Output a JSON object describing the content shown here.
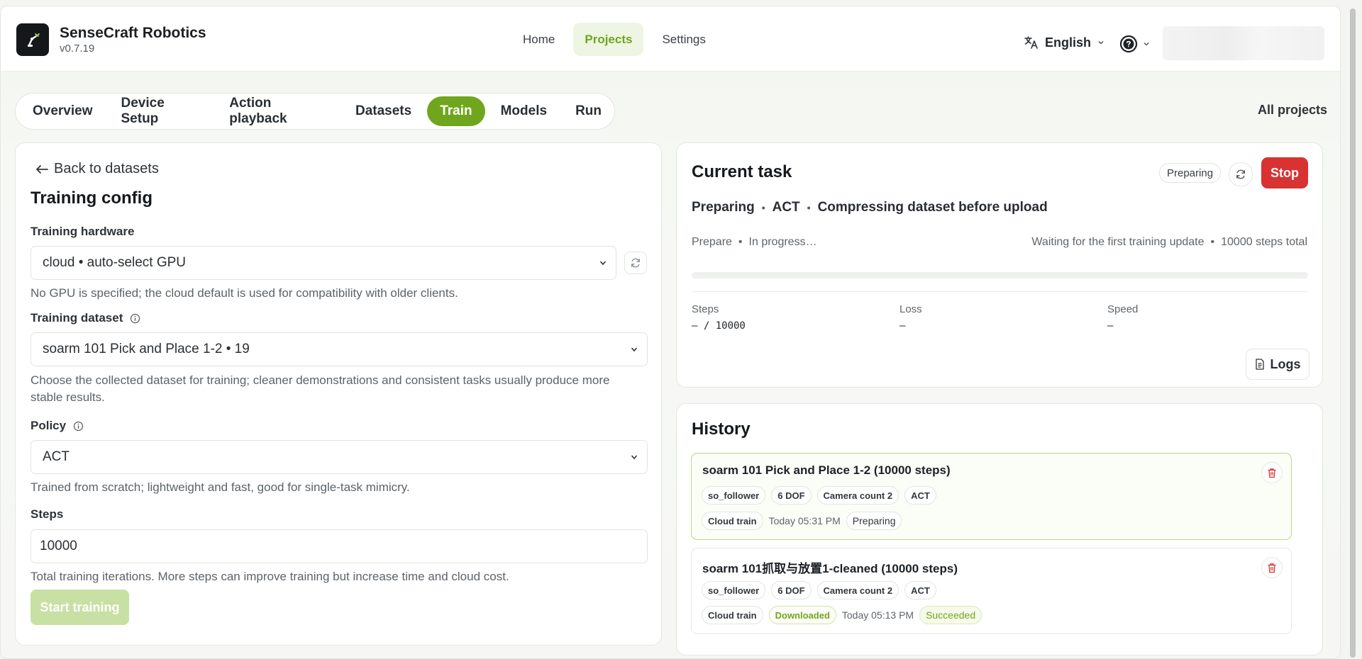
{
  "brand": {
    "name": "SenseCraft Robotics",
    "version": "v0.7.19"
  },
  "topnav": [
    {
      "label": "Home"
    },
    {
      "label": "Projects"
    },
    {
      "label": "Settings"
    }
  ],
  "header": {
    "language": "English"
  },
  "subnav": {
    "tabs": [
      {
        "label": "Overview"
      },
      {
        "label": "Device Setup"
      },
      {
        "label": "Action playback"
      },
      {
        "label": "Datasets"
      },
      {
        "label": "Train"
      },
      {
        "label": "Models"
      },
      {
        "label": "Run"
      }
    ],
    "all_projects": "All projects"
  },
  "training": {
    "back": "Back to datasets",
    "title": "Training config",
    "hardware_label": "Training hardware",
    "hardware_value": "cloud • auto-select GPU",
    "hardware_help": "No GPU is specified; the cloud default is used for compatibility with older clients.",
    "dataset_label": "Training dataset",
    "dataset_value": "soarm 101 Pick and Place 1-2 • 19",
    "dataset_help": "Choose the collected dataset for training; cleaner demonstrations and consistent tasks usually produce more stable results.",
    "policy_label": "Policy",
    "policy_value": "ACT",
    "policy_help": "Trained from scratch; lightweight and fast, good for single-task mimicry.",
    "steps_label": "Steps",
    "steps_value": "10000",
    "steps_help": "Total training iterations. More steps can improve training but increase time and cloud cost.",
    "start": "Start training"
  },
  "current_task": {
    "title": "Current task",
    "status_badge": "Preparing",
    "stop": "Stop",
    "status": "Preparing",
    "policy": "ACT",
    "detail": "Compressing dataset before upload",
    "phase": "Prepare",
    "phase_status": "In progress…",
    "waiting": "Waiting for the first training update",
    "total_steps": "10000 steps total",
    "progress": 0,
    "steps_label": "Steps",
    "steps_value": "– / 10000",
    "loss_label": "Loss",
    "loss_value": "–",
    "speed_label": "Speed",
    "speed_value": "–",
    "logs": "Logs"
  },
  "history": {
    "title": "History",
    "items": [
      {
        "title": "soarm 101 Pick and Place 1-2 (10000 steps)",
        "robot": "so_follower",
        "dof": "6 DOF",
        "cameras": "Camera count 2",
        "policy": "ACT",
        "mode": "Cloud train",
        "time": "Today 05:31 PM",
        "status": "Preparing"
      },
      {
        "title": "soarm 101抓取与放置1-cleaned (10000 steps)",
        "robot": "so_follower",
        "dof": "6 DOF",
        "cameras": "Camera count 2",
        "policy": "ACT",
        "mode": "Cloud train",
        "downloaded": "Downloaded",
        "time": "Today 05:13 PM",
        "status": "Succeeded"
      }
    ]
  },
  "colors": {
    "accent": "#6fa61d",
    "danger": "#d83232",
    "start_disabled": "#c8e0a4"
  }
}
